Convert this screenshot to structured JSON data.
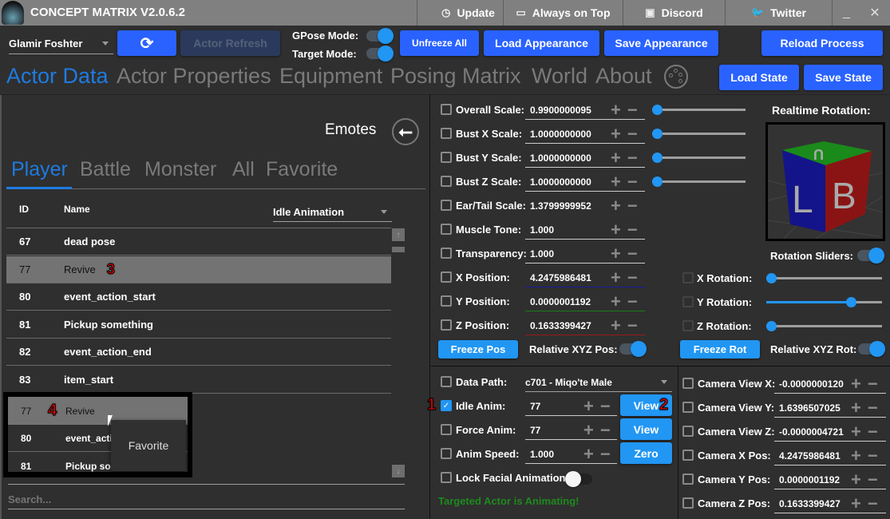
{
  "titlebar": {
    "title": "CONCEPT MATRIX V2.0.6.2",
    "buttons": [
      {
        "label": "Update",
        "icon": "clock-icon"
      },
      {
        "label": "Always on Top",
        "icon": "toggle-icon"
      },
      {
        "label": "Discord",
        "icon": "discord-icon"
      },
      {
        "label": "Twitter",
        "icon": "twitter-icon"
      }
    ],
    "minimize": "_",
    "close": "✕"
  },
  "toolbar": {
    "actor_select": "Glamir Foshter",
    "refresh_icon": "⟳",
    "actor_refresh": "Actor Refresh",
    "gpose_label": "GPose Mode:",
    "target_label": "Target Mode:",
    "gpose_on": true,
    "target_on": true,
    "unfreeze_all": "Unfreeze All",
    "load_appearance": "Load Appearance",
    "save_appearance": "Save Appearance",
    "reload_process": "Reload Process",
    "load_state": "Load State",
    "save_state": "Save State"
  },
  "main_tabs": [
    "Actor Data",
    "Actor Properties",
    "Equipment",
    "Posing Matrix",
    "World",
    "About"
  ],
  "active_main_tab": "Actor Data",
  "emotes": {
    "title": "Emotes",
    "tabs": [
      "Player",
      "Battle",
      "Monster",
      "All",
      "Favorite"
    ],
    "active_tab": "Player",
    "columns": {
      "id": "ID",
      "name": "Name"
    },
    "filter_select": "Idle Animation",
    "rows": [
      {
        "id": "67",
        "name": "dead pose"
      },
      {
        "id": "77",
        "name": "Revive",
        "selected": true
      },
      {
        "id": "80",
        "name": "event_action_start"
      },
      {
        "id": "81",
        "name": "Pickup something"
      },
      {
        "id": "82",
        "name": "event_action_end"
      },
      {
        "id": "83",
        "name": "item_start"
      }
    ],
    "inset_rows": [
      {
        "id": "77",
        "name": "Revive",
        "selected": true
      },
      {
        "id": "80",
        "name": "event_acti"
      },
      {
        "id": "81",
        "name": "Pickup so"
      }
    ],
    "context_menu": {
      "item": "Favorite"
    },
    "search_placeholder": "Search...",
    "annotations": {
      "row_badge": "3",
      "inset_badge": "4"
    }
  },
  "scales": [
    {
      "label": "Overall Scale:",
      "value": "0.9900000095",
      "slider": 0.0
    },
    {
      "label": "Bust X Scale:",
      "value": "1.0000000000",
      "slider": 0.0
    },
    {
      "label": "Bust Y Scale:",
      "value": "1.0000000000",
      "slider": 0.0
    },
    {
      "label": "Bust Z Scale:",
      "value": "1.0000000000",
      "slider": 0.0
    },
    {
      "label": "Ear/Tail Scale:",
      "value": "1.3799999952"
    },
    {
      "label": "Muscle Tone:",
      "value": "1.000"
    },
    {
      "label": "Transparency:",
      "value": "1.000"
    },
    {
      "label": "X Position:",
      "value": "4.2475986481",
      "underline": "#1a1a9a"
    },
    {
      "label": "Y Position:",
      "value": "0.0000001192",
      "underline": "#1a7a1a"
    },
    {
      "label": "Z Position:",
      "value": "0.1633399427",
      "underline": "#9a1a1a"
    }
  ],
  "position_controls": {
    "freeze_pos": "Freeze Pos",
    "relative_pos": "Relative XYZ Pos:",
    "relative_pos_on": true
  },
  "rotation": {
    "title": "Realtime Rotation:",
    "cube_faces": {
      "top": "U",
      "left": "L",
      "right": "B"
    },
    "sliders_label": "Rotation Sliders:",
    "sliders_on": true,
    "items": [
      {
        "label": "X Rotation:",
        "value": 0.0
      },
      {
        "label": "Y Rotation:",
        "value": 0.76
      },
      {
        "label": "Z Rotation:",
        "value": 0.0
      }
    ],
    "freeze_rot": "Freeze Rot",
    "relative_rot": "Relative XYZ Rot:",
    "relative_rot_on": true
  },
  "animation": {
    "data_path_label": "Data Path:",
    "data_path_value": "c701 - Miqo'te Male",
    "idle_label": "Idle Anim:",
    "idle_value": "77",
    "idle_checked": true,
    "force_label": "Force Anim:",
    "force_value": "77",
    "speed_label": "Anim Speed:",
    "speed_value": "1.000",
    "view_label": "View",
    "zero_label": "Zero",
    "lock_facial_label": "Lock Facial Animation:",
    "lock_facial_on": false,
    "status": "Targeted Actor is Animating!",
    "status_color": "#1e8a1e",
    "annotations": {
      "checkbox_badge": "1",
      "view_badge": "2"
    }
  },
  "camera": [
    {
      "label": "Camera View X:",
      "value": "-0.0000000120"
    },
    {
      "label": "Camera View Y:",
      "value": "1.6396507025"
    },
    {
      "label": "Camera View Z:",
      "value": "-0.0000004721"
    },
    {
      "label": "Camera X Pos:",
      "value": "4.2475986481"
    },
    {
      "label": "Camera Y Pos:",
      "value": "0.0000001192"
    },
    {
      "label": "Camera Z Pos:",
      "value": "0.1633399427"
    }
  ],
  "colors": {
    "accent": "#2962ff",
    "light_accent": "#2196f3",
    "tab_active": "#1e7be0",
    "background": "#2f2f2f",
    "titlebar": "#808080"
  }
}
